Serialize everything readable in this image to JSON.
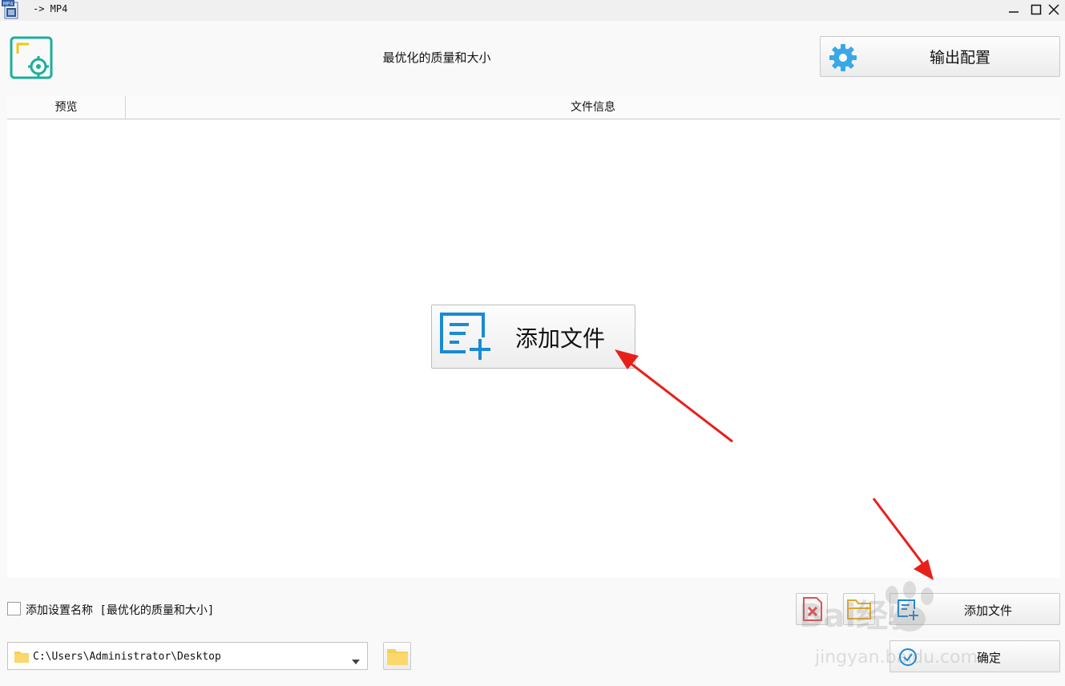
{
  "window": {
    "title": "-> MP4",
    "app_icon_badge": "MP4",
    "controls": [
      "minimize-icon",
      "maximize-icon",
      "close-icon"
    ]
  },
  "header": {
    "preset_title": "最优化的质量和大小",
    "output_config_label": "输出配置"
  },
  "table": {
    "columns": [
      "预览",
      "文件信息"
    ],
    "rows": []
  },
  "center_add_button": {
    "label": "添加文件"
  },
  "options": {
    "add_preset_name_label": "添加设置名称 [最优化的质量和大小]",
    "add_preset_name_checked": false
  },
  "output_path": {
    "value": "C:\\Users\\Administrator\\Desktop"
  },
  "actions": {
    "add_files_label": "添加文件",
    "ok_label": "确定"
  },
  "colors": {
    "accent_teal": "#1cae9a",
    "accent_yellow": "#f5c518",
    "gear_blue": "#3aa8e6",
    "add_file_blue": "#1a8ad4",
    "annotation_red": "#e8201a"
  },
  "watermark": {
    "text_top": "Bai经验",
    "text_bottom": "jingyan.baidu.com"
  }
}
